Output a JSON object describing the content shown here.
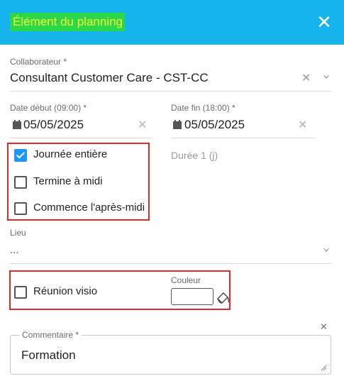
{
  "header": {
    "title": "Élément du planning",
    "close": "✕"
  },
  "collaborateur": {
    "label": "Collaborateur *",
    "value": "Consultant Customer Care - CST-CC",
    "clear": "✕"
  },
  "date_debut": {
    "label": "Date début (09:00) *",
    "value": "05/05/2025",
    "clear": "✕"
  },
  "date_fin": {
    "label": "Date fin (18:00) *",
    "value": "05/05/2025",
    "clear": "✕"
  },
  "options": [
    {
      "label": "Journée entière",
      "checked": true
    },
    {
      "label": "Termine à midi",
      "checked": false
    },
    {
      "label": "Commence l'après-midi",
      "checked": false
    }
  ],
  "duree": "Durée 1 (j)",
  "lieu": {
    "label": "Lieu",
    "value": "..."
  },
  "reunion": {
    "label": "Réunion visio",
    "checked": false
  },
  "couleur": {
    "label": "Couleur"
  },
  "commentaire": {
    "label": "Commentaire *",
    "value": "Formation",
    "clear": "✕"
  },
  "colors": {
    "header": "#16b4ec",
    "title_bg": "#2bd84a",
    "title_text": "#f6ff32",
    "highlight": "#e32a2a",
    "checkbox": "#2196f3"
  }
}
